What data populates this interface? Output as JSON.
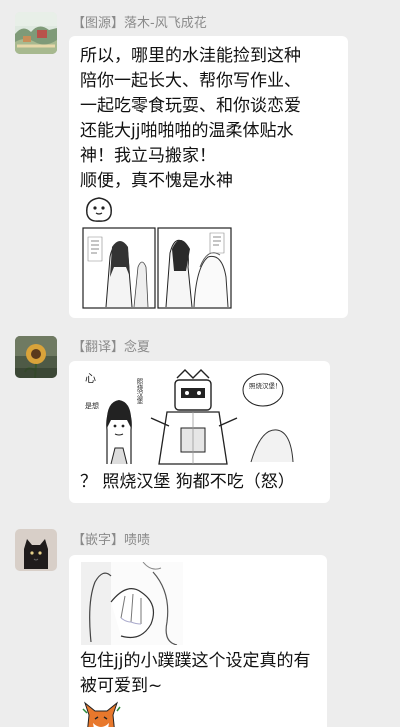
{
  "messages": [
    {
      "sender": "【图源】落木-风飞成花",
      "lines": [
        "所以，哪里的水洼能捡到这种",
        "陪你一起长大、帮你写作业、",
        "一起吃零食玩耍、和你谈恋爱",
        "还能大jj啪啪啪的温柔体贴水",
        "神！我立马搬家！",
        "顺便，真不愧是水神"
      ],
      "avatar_icon": "landscape-avatar-icon",
      "image": "water-spirit-comic-image"
    },
    {
      "sender": "【翻译】念夏",
      "lines": [
        "？ 照烧汉堡 狗都不吃（怒）"
      ],
      "avatar_icon": "sunflower-avatar-icon",
      "image": "robot-girl-comic-image",
      "comic_texts": [
        "心",
        "是想",
        "照烧汉堡",
        "照烧汉堡！"
      ]
    },
    {
      "sender": "【嵌字】啧啧",
      "lines": [
        "包住jj的小蹼蹼这个设定真的有",
        "被可爱到~"
      ],
      "avatar_icon": "black-cat-avatar-icon",
      "image": "webbed-hand-comic-image"
    }
  ],
  "colors": {
    "background": "#ededed",
    "bubble": "#ffffff",
    "sender_text": "#8a8a8a",
    "message_text": "#111111"
  }
}
